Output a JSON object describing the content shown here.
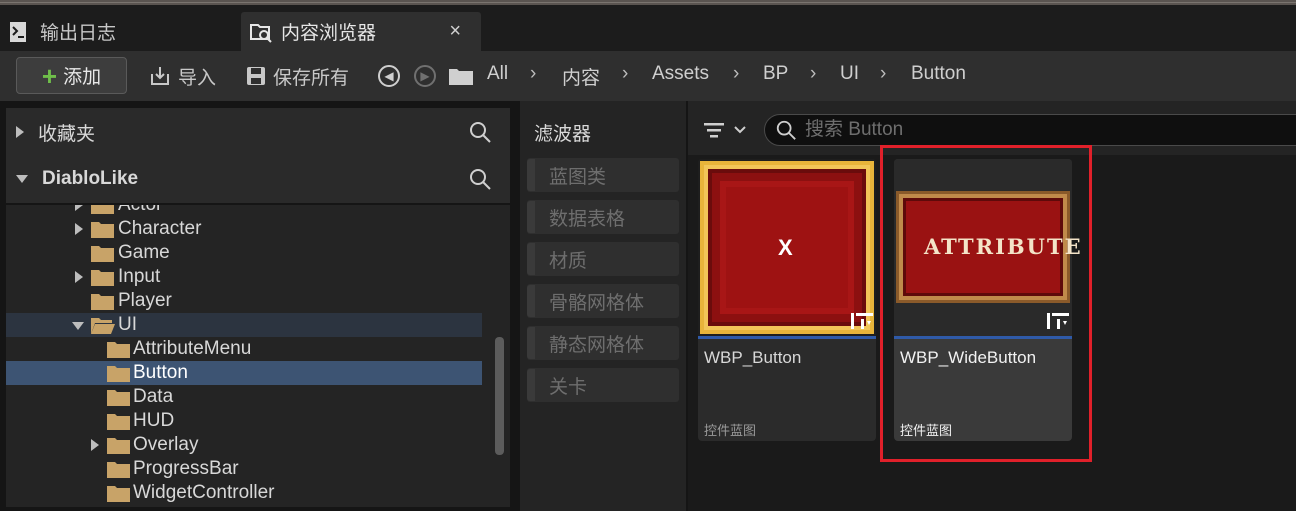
{
  "tabs": [
    {
      "label": "输出日志",
      "icon": "output-log-icon"
    },
    {
      "label": "内容浏览器",
      "icon": "content-browser-icon",
      "close": "×"
    }
  ],
  "toolbar": {
    "add_label": "添加",
    "import_label": "导入",
    "save_all_label": "保存所有"
  },
  "breadcrumb": [
    "All",
    "内容",
    "Assets",
    "BP",
    "UI",
    "Button"
  ],
  "breadcrumb_sep": "›",
  "sidebar": {
    "favorites_label": "收藏夹",
    "project_label": "DiabloLike",
    "tree": [
      {
        "label": "Actor"
      },
      {
        "label": "Character"
      },
      {
        "label": "Game"
      },
      {
        "label": "Input"
      },
      {
        "label": "Player"
      },
      {
        "label": "UI"
      },
      {
        "label": "AttributeMenu"
      },
      {
        "label": "Button"
      },
      {
        "label": "Data"
      },
      {
        "label": "HUD"
      },
      {
        "label": "Overlay"
      },
      {
        "label": "ProgressBar"
      },
      {
        "label": "WidgetController"
      }
    ]
  },
  "filters": {
    "title": "滤波器",
    "items": [
      "蓝图类",
      "数据表格",
      "材质",
      "骨骼网格体",
      "静态网格体",
      "关卡"
    ]
  },
  "search": {
    "placeholder": "搜索 Button"
  },
  "assets": [
    {
      "name": "WBP_Button",
      "type": "控件蓝图",
      "thumb_text": "X"
    },
    {
      "name": "WBP_WideButton",
      "type": "控件蓝图",
      "thumb_text": "ATTRIBUTE"
    }
  ],
  "colors": {
    "accent": "#2f5aa8",
    "highlight": "#e0202a",
    "folder": "#c8a368",
    "add_plus": "#6fbf4a"
  }
}
